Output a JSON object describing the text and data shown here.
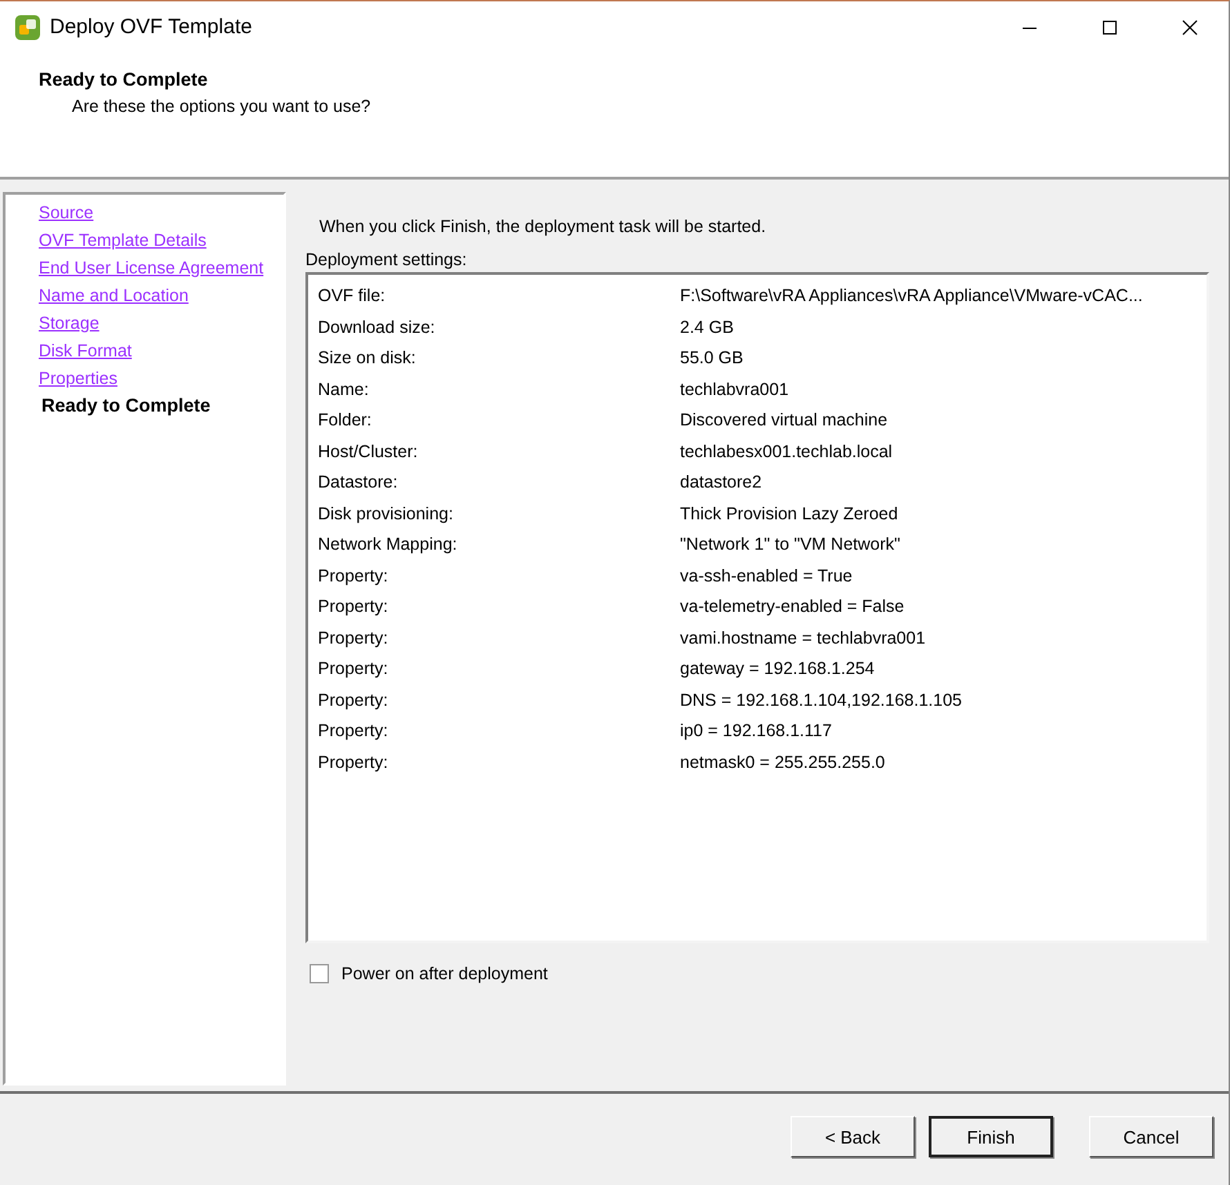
{
  "window": {
    "title": "Deploy OVF Template"
  },
  "header": {
    "title": "Ready to Complete",
    "subtitle": "Are these the options you want to use?"
  },
  "steps": [
    {
      "label": "Source",
      "selected": false
    },
    {
      "label": "OVF Template Details",
      "selected": false
    },
    {
      "label": "End User License Agreement",
      "selected": false
    },
    {
      "label": "Name and Location",
      "selected": false
    },
    {
      "label": "Storage",
      "selected": false
    },
    {
      "label": "Disk Format",
      "selected": false
    },
    {
      "label": "Properties",
      "selected": false
    },
    {
      "label": "Ready to Complete",
      "selected": true
    }
  ],
  "intro": "When you click Finish, the deployment task will be started.",
  "settings_label": "Deployment settings:",
  "settings": [
    {
      "name": "OVF file:",
      "value": "F:\\Software\\vRA Appliances\\vRA Appliance\\VMware-vCAC..."
    },
    {
      "name": "Download size:",
      "value": "2.4 GB"
    },
    {
      "name": "Size on disk:",
      "value": "55.0 GB"
    },
    {
      "name": "Name:",
      "value": "techlabvra001"
    },
    {
      "name": "Folder:",
      "value": "Discovered virtual machine"
    },
    {
      "name": "Host/Cluster:",
      "value": "techlabesx001.techlab.local"
    },
    {
      "name": "Datastore:",
      "value": "datastore2"
    },
    {
      "name": "Disk provisioning:",
      "value": "Thick Provision Lazy Zeroed"
    },
    {
      "name": "Network Mapping:",
      "value": "\"Network 1\" to \"VM Network\""
    },
    {
      "name": "Property:",
      "value": "va-ssh-enabled = True"
    },
    {
      "name": "Property:",
      "value": "va-telemetry-enabled = False"
    },
    {
      "name": "Property:",
      "value": "vami.hostname = techlabvra001"
    },
    {
      "name": "Property:",
      "value": "gateway = 192.168.1.254"
    },
    {
      "name": "Property:",
      "value": "DNS = 192.168.1.104,192.168.1.105"
    },
    {
      "name": "Property:",
      "value": "ip0 = 192.168.1.117"
    },
    {
      "name": "Property:",
      "value": "netmask0 = 255.255.255.0"
    }
  ],
  "power_on": {
    "label": "Power on after deployment",
    "checked": false
  },
  "buttons": [
    "< Back",
    "Finish",
    "Cancel"
  ]
}
